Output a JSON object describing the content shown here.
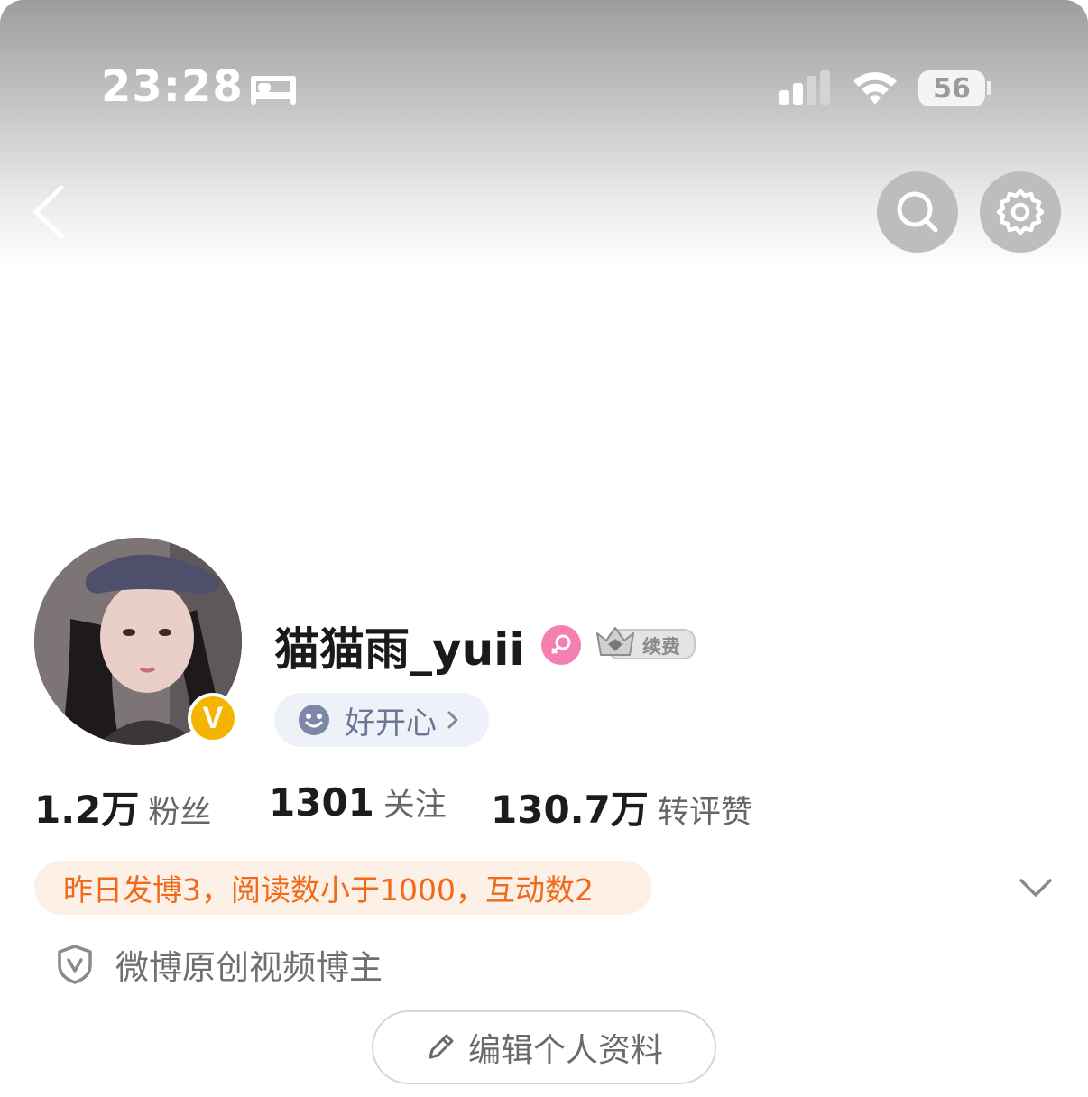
{
  "status_bar": {
    "time": "23:28",
    "battery": "56",
    "icons": [
      "bed-icon",
      "cellular-signal-icon",
      "wifi-icon",
      "battery-icon"
    ]
  },
  "nav": {
    "icons": [
      "back-chevron-icon",
      "search-icon",
      "gear-icon"
    ]
  },
  "profile": {
    "username": "猫猫雨_yuii",
    "verified_badge": "V",
    "vip_label": "续费",
    "mood": "好开心",
    "colors": {
      "verified": "#f5b400",
      "gender_female": "#f47fb0",
      "mood_text": "#6b7696",
      "highlight_text": "#ef6a1a",
      "highlight_bg": "#fdf0e6"
    }
  },
  "stats": [
    {
      "value": "1.2万",
      "label": "粉丝"
    },
    {
      "value": "1301",
      "label": "关注"
    },
    {
      "value": "130.7万",
      "label": "转评赞"
    }
  ],
  "yesterday_summary": "昨日发博3，阅读数小于1000，互动数2",
  "creator_tag": "微博原创视频博主",
  "edit_profile_button": "编辑个人资料"
}
